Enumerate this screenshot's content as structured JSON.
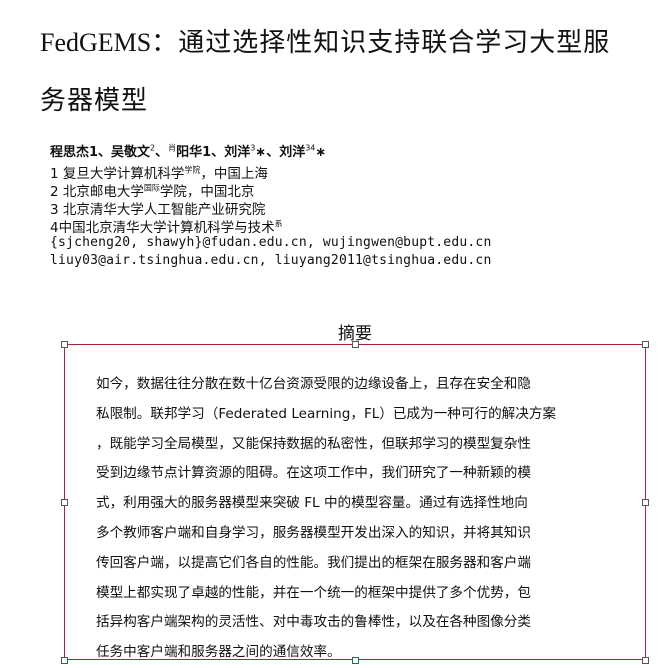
{
  "title": {
    "line1_prefix": "FedGEMS",
    "line1_rest": "：通过选择性知识支持联合学习大型服",
    "line2": "务器模型"
  },
  "authors": [
    {
      "name": "程思杰",
      "sup": "1"
    },
    {
      "name": "吴敬文",
      "sup": "2"
    },
    {
      "name": "肖阳华",
      "sup": "1"
    },
    {
      "name": "刘洋",
      "sup": "3∗"
    },
    {
      "name": "刘洋",
      "sup": "34∗"
    }
  ],
  "authors_text": {
    "a1": "程思杰1、吴敬文",
    "a1_sup": "2",
    "a2_pre": "、",
    "a2_small": "肖",
    "a2": "阳华1、刘洋",
    "a2_sup": "3",
    "a3": "∗、刘洋",
    "a3_sup": "34",
    "a3_end": "∗"
  },
  "affiliations": {
    "l1": "1 复旦大学计算机科学",
    "l1_sup": "学院",
    "l1_end": "，中国上海",
    "l2": "2 北京邮电大学",
    "l2_sup": "国际",
    "l2_end": "学院，中国北京",
    "l3": "3 北京清华大学人工智能产业研究院",
    "l4": "4中国北京清华大学计算机科学与技术",
    "l4_sup": "系"
  },
  "emails": {
    "line1": "{sjcheng20, shawyh}@fudan.edu.cn, wujingwen@bupt.edu.cn",
    "line2": "liuy03@air.tsinghua.edu.cn, liuyang2011@tsinghua.edu.cn"
  },
  "abstract": {
    "heading": "摘要",
    "lines": [
      "如今，数据往往分散在数十亿台资源受限的边缘设备上，且存在安全和隐",
      "私限制。联邦学习（Federated Learning，FL）已成为一种可行的解决方案",
      "，既能学习全局模型，又能保持数据的私密性，但联邦学习的模型复杂性",
      "受到边缘节点计算资源的阻碍。在这项工作中，我们研究了一种新颖的模",
      "式，利用强大的服务器模型来突破 FL 中的模型容量。通过有选择性地向",
      "多个教师客户端和自身学习，服务器模型开发出深入的知识，并将其知识",
      "传回客户端，以提高它们各自的性能。我们提出的框架在服务器和客户端",
      "模型上都实现了卓越的性能，并在一个统一的框架中提供了多个优势，包",
      "括异构客户端架构的灵活性、对中毒攻击的鲁棒性，以及在各种图像分类",
      "任务中客户端和服务器之间的通信效率。"
    ]
  },
  "colors": {
    "selection_border": "#a8243a"
  }
}
